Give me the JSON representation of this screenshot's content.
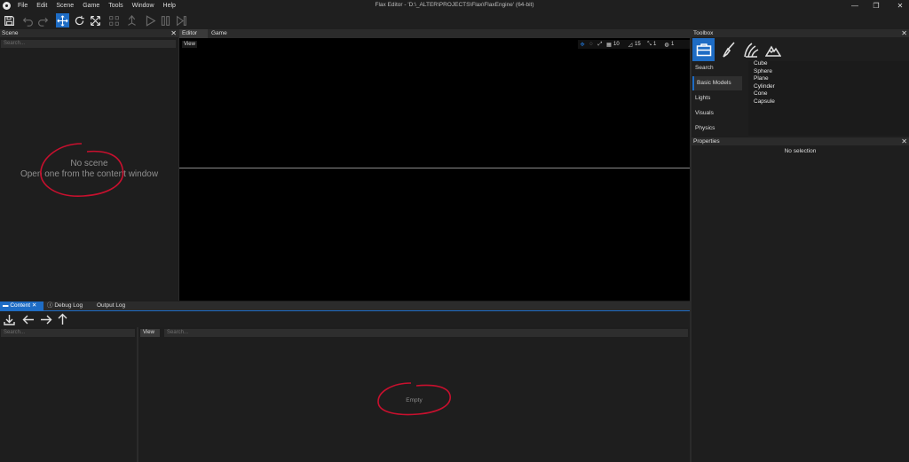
{
  "window": {
    "title": "Flax Editor - 'D:\\_ALTER\\PROJECTS\\Flax\\FlaxEngine' (64-bit)",
    "minimize": "—",
    "maximize": "❐",
    "close": "✕"
  },
  "menu": [
    "File",
    "Edit",
    "Scene",
    "Game",
    "Tools",
    "Window",
    "Help"
  ],
  "scene_panel": {
    "title": "Scene",
    "search_placeholder": "Search...",
    "message_line1": "No scene",
    "message_line2": "Open one from the content window"
  },
  "viewport": {
    "tabs": [
      "Editor",
      "Game"
    ],
    "view_button": "View",
    "grid_value": "10",
    "angle_value": "15",
    "scale_value": "1",
    "camera_speed": "1"
  },
  "toolbox": {
    "title": "Toolbox",
    "categories": [
      "Search",
      "Basic Models",
      "Lights",
      "Visuals",
      "Physics"
    ],
    "selected_category": "Basic Models",
    "models": [
      "Cube",
      "Sphere",
      "Plane",
      "Cylinder",
      "Cone",
      "Capsule"
    ]
  },
  "properties": {
    "title": "Properties",
    "message": "No selection"
  },
  "bottom_tabs": [
    "Content",
    "Debug Log",
    "Output Log"
  ],
  "content": {
    "tree_search_placeholder": "Search...",
    "view_button": "View",
    "search_placeholder": "Search...",
    "empty_message": "Empty"
  },
  "colors": {
    "accent": "#1e6cc4",
    "background": "#1e1e1e",
    "annotation": "#c8102e"
  }
}
